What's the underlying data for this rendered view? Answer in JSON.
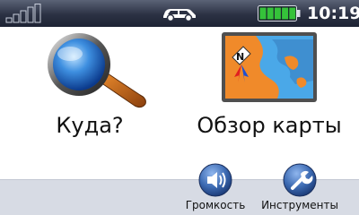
{
  "status_bar": {
    "signal_icon": "gps-signal-bars-icon",
    "vehicle_icon": "car-icon",
    "battery_icon": "battery-icon",
    "battery_level": 1.0,
    "time": "10:19"
  },
  "main": {
    "where_to": {
      "label": "Куда?",
      "icon": "magnifier-icon"
    },
    "view_map": {
      "label": "Обзор карты",
      "icon": "map-icon"
    }
  },
  "bottom": {
    "volume": {
      "label": "Громкость",
      "icon": "speaker-icon"
    },
    "tools": {
      "label": "Инструменты",
      "icon": "wrench-icon"
    }
  },
  "colors": {
    "status_bar": "#2b3143",
    "battery_fill": "#35c23a",
    "bottom_bar": "#d7dbe4",
    "button_blue": "#3d6bb3"
  }
}
